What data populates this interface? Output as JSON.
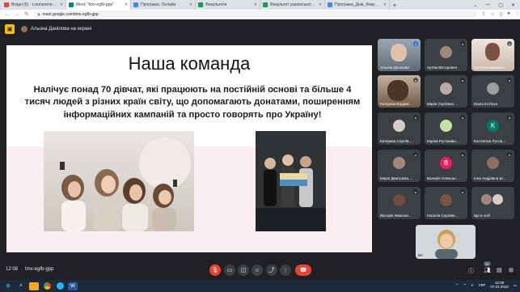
{
  "browser": {
    "tabs": [
      {
        "label": "Вхідні (6) - t.semerene-vari@nu…",
        "color": "#ea4335"
      },
      {
        "label": "Meet: \"tmx-egfb-gpp\"",
        "color": "#00897b",
        "active": true
      },
      {
        "label": "Програма. Онлайн",
        "color": "#4285f4"
      },
      {
        "label": "Факультети",
        "color": "#0f9d58"
      },
      {
        "label": "Факультет української філолог…",
        "color": "#0f9d58"
      },
      {
        "label": "Програма_Днів_Факультету_2024…",
        "color": "#4285f4"
      }
    ],
    "new_tab": "+",
    "url": "meet.google.com/tmx-egfb-gpp"
  },
  "meet": {
    "presenter_label": "Альона Данілова на екрані",
    "meeting_time": "12:08",
    "meeting_code": "tmx-egfb-gpp",
    "people_count": "37"
  },
  "slide": {
    "title": "Наша команда",
    "body": "Налічує понад 70 дівчат, які працюють на постійній основі та більше 4 тисяч людей з різних країн світу, що допомагають донатами, поширенням інформаційних кампаній та просто говорять про Україну!"
  },
  "participants": [
    {
      "name": "Альона Данілова",
      "kind": "video",
      "speaking": true,
      "color": "#7a8a99"
    },
    {
      "name": "Артем Вікторович",
      "kind": "photo",
      "color": "#a1887f"
    },
    {
      "name": "Світлана Іванівна",
      "kind": "video",
      "color": "#8d6e63"
    },
    {
      "name": "Катерина Вадимі…",
      "kind": "video",
      "color": "#6d4c41"
    },
    {
      "name": "Марія Сергіївна …",
      "kind": "photo",
      "color": "#bcaaa4"
    },
    {
      "name": "Diana Kozlova",
      "kind": "photo",
      "color": "#9e9e9e"
    },
    {
      "name": "Катерина Сергіїв…",
      "kind": "photo",
      "color": "#d7ccc8"
    },
    {
      "name": "Каріна Русланівн…",
      "kind": "photo",
      "color": "#c5e1a5"
    },
    {
      "name": "Костянтин Русла…",
      "kind": "letter",
      "letter": "K",
      "color": "#00796b"
    },
    {
      "name": "Марія Дмитрієва…",
      "kind": "photo",
      "color": "#a1887f"
    },
    {
      "name": "Валерія Олексан…",
      "kind": "letter",
      "letter": "B",
      "color": "#e91e63"
    },
    {
      "name": "Інна Андріївна Ш…",
      "kind": "photo",
      "color": "#8d6e63"
    },
    {
      "name": "Вікторія Миколаї…",
      "kind": "photo",
      "color": "#6d4c41"
    },
    {
      "name": "Наталія Сергіївн…",
      "kind": "photo",
      "color": "#795548"
    },
    {
      "name": "Ще 5 осіб",
      "kind": "group",
      "color": "#a1887f"
    }
  ],
  "self_view": {
    "name": "Ви"
  },
  "taskbar": {
    "lang": "УКР",
    "time": "12:08",
    "date": "07.04.2023"
  }
}
